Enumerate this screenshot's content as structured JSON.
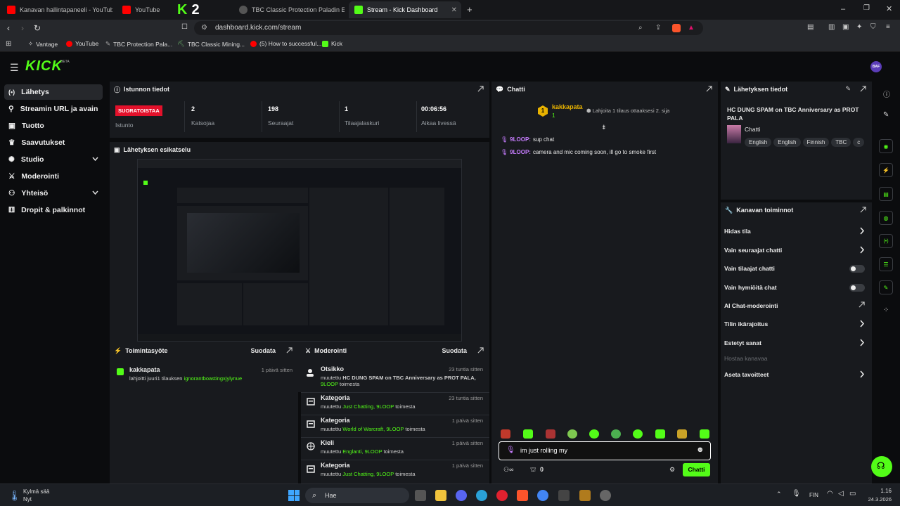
{
  "browser": {
    "tabs": [
      {
        "label": "Kanavan hallintapaneeli - YouTube Studio",
        "active": false
      },
      {
        "label": "YouTube",
        "active": false
      },
      {
        "label": "",
        "active": false
      },
      {
        "label": "TBC Classic Protection Paladin Enchants",
        "active": false
      },
      {
        "label": "Stream - Kick Dashboard",
        "active": true
      }
    ],
    "url": "dashboard.kick.com/stream",
    "bookmarks": [
      "Vantage",
      "YouTube",
      "TBC Protection Pala...",
      "TBC Classic Mining...",
      "(5) How to successful...",
      "Kick"
    ]
  },
  "app": {
    "logo": "KICK",
    "logo_badge": "BETA",
    "avatar": "BAF"
  },
  "sidebar": {
    "items": [
      {
        "label": "Lähetys",
        "icon": "broadcast-icon"
      },
      {
        "label": "Streamin URL ja avain",
        "icon": "link-icon"
      },
      {
        "label": "Tuotto",
        "icon": "wallet-icon"
      },
      {
        "label": "Saavutukset",
        "icon": "trophy-icon"
      },
      {
        "label": "Studio",
        "icon": "studio-icon"
      },
      {
        "label": "Moderointi",
        "icon": "sword-icon"
      },
      {
        "label": "Yhteisö",
        "icon": "community-icon"
      },
      {
        "label": "Dropit & palkinnot",
        "icon": "gift-icon"
      }
    ]
  },
  "session": {
    "title": "Istunnon tiedot",
    "live_badge": "SUORATOISTAA",
    "stats": [
      {
        "value": "",
        "label": "Istunto"
      },
      {
        "value": "2",
        "label": "Katsojaa"
      },
      {
        "value": "198",
        "label": "Seuraajat"
      },
      {
        "value": "1",
        "label": "Tilaajalaskuri"
      },
      {
        "value": "00:06:56",
        "label": "Aikaa livessä"
      }
    ]
  },
  "preview": {
    "title": "Lähetyksen esikatselu"
  },
  "activity": {
    "title": "Toimintasyöte",
    "filter": "Suodata",
    "user": "kakkapata",
    "time": "1 päivä sitten",
    "text_a": "lahjoitti juuri",
    "text_b": "1 tilauksen",
    "target": "ignorantboastingxjylynue"
  },
  "moderation": {
    "title": "Moderointi",
    "filter": "Suodata",
    "rows": [
      {
        "title": "Otsikko",
        "pre": "muutettu",
        "value": "HC DUNG SPAM on TBC Anniversary as PROT PALA,",
        "by": "9LOOP",
        "post": "toimesta",
        "time": "23 tuntia sitten"
      },
      {
        "title": "Kategoria",
        "pre": "muutettu",
        "value": "Just Chatting,",
        "by": "9LOOP",
        "post": "toimesta",
        "time": "23 tuntia sitten"
      },
      {
        "title": "Kategoria",
        "pre": "muutettu",
        "value": "World of Warcraft,",
        "by": "9LOOP",
        "post": "toimesta",
        "time": "1 päivä sitten"
      },
      {
        "title": "Kieli",
        "pre": "muutettu",
        "value": "Englanti,",
        "by": "9LOOP",
        "post": "toimesta",
        "time": "1 päivä sitten"
      },
      {
        "title": "Kategoria",
        "pre": "muutettu",
        "value": "Just Chatting,",
        "by": "9LOOP",
        "post": "toimesta",
        "time": "1 päivä sitten"
      }
    ]
  },
  "chat": {
    "title": "Chatti",
    "pinned_user": "kakkapata",
    "pinned_count": "1",
    "pinned_text": "Lahjoita 1 tilaus ottaaksesi 2. sija",
    "messages": [
      {
        "user": "9LOOP:",
        "text": "sup chat"
      },
      {
        "user": "9LOOP:",
        "text": "camera and mic coming soon, ill go to smoke first"
      }
    ],
    "input_value": "im just rolling my",
    "points": "0",
    "send_label": "Chatti"
  },
  "stream_info": {
    "title": "Lähetyksen tiedot",
    "stream_title": "HC DUNG SPAM on TBC Anniversary as PROT PALA",
    "category": "Chatti",
    "tags": [
      "English",
      "English",
      "Finnish",
      "TBC",
      "c"
    ]
  },
  "channel_actions": {
    "title": "Kanavan toiminnot",
    "items": [
      {
        "label": "Hidas tila",
        "control": "chevron"
      },
      {
        "label": "Vain seuraajat chatti",
        "control": "chevron"
      },
      {
        "label": "Vain tilaajat chatti",
        "control": "toggle"
      },
      {
        "label": "Vain hymiöitä chat",
        "control": "toggle"
      },
      {
        "label": "AI Chat-moderointi",
        "control": "external"
      },
      {
        "label": "Tilin ikärajoitus",
        "control": "chevron"
      },
      {
        "label": "Estetyt sanat",
        "control": "chevron"
      },
      {
        "label": "Hostaa kanavaa",
        "control": "none"
      },
      {
        "label": "Aseta tavoitteet",
        "control": "chevron"
      }
    ]
  },
  "taskbar": {
    "weather_title": "Kylmä sää",
    "weather_sub": "Nyt",
    "search": "Hae",
    "lang": "FIN",
    "time": "1.16",
    "date": "24.3.2026"
  },
  "colors": {
    "accent": "#53fc18",
    "live": "#e3112b",
    "chat_user": "#c77dff"
  }
}
